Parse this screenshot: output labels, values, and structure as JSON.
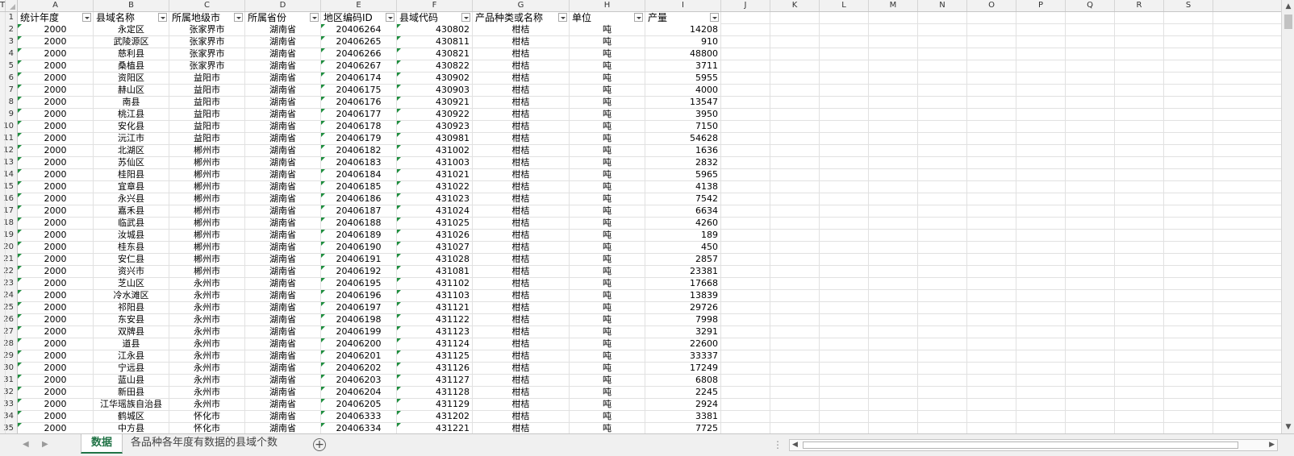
{
  "columns": [
    "A",
    "B",
    "C",
    "D",
    "E",
    "F",
    "G",
    "H",
    "I",
    "J",
    "K",
    "L",
    "M",
    "N",
    "O",
    "P",
    "Q",
    "R",
    "S",
    "T"
  ],
  "headers": [
    "统计年度",
    "县域名称",
    "所属地级市",
    "所属省份",
    "地区编码ID",
    "县域代码",
    "产品种类或名称",
    "单位",
    "产量"
  ],
  "rows": [
    [
      "2000",
      "永定区",
      "张家界市",
      "湖南省",
      "20406264",
      "430802",
      "柑桔",
      "吨",
      "14208"
    ],
    [
      "2000",
      "武陵源区",
      "张家界市",
      "湖南省",
      "20406265",
      "430811",
      "柑桔",
      "吨",
      "910"
    ],
    [
      "2000",
      "慈利县",
      "张家界市",
      "湖南省",
      "20406266",
      "430821",
      "柑桔",
      "吨",
      "48800"
    ],
    [
      "2000",
      "桑植县",
      "张家界市",
      "湖南省",
      "20406267",
      "430822",
      "柑桔",
      "吨",
      "3711"
    ],
    [
      "2000",
      "资阳区",
      "益阳市",
      "湖南省",
      "20406174",
      "430902",
      "柑桔",
      "吨",
      "5955"
    ],
    [
      "2000",
      "赫山区",
      "益阳市",
      "湖南省",
      "20406175",
      "430903",
      "柑桔",
      "吨",
      "4000"
    ],
    [
      "2000",
      "南县",
      "益阳市",
      "湖南省",
      "20406176",
      "430921",
      "柑桔",
      "吨",
      "13547"
    ],
    [
      "2000",
      "桃江县",
      "益阳市",
      "湖南省",
      "20406177",
      "430922",
      "柑桔",
      "吨",
      "3950"
    ],
    [
      "2000",
      "安化县",
      "益阳市",
      "湖南省",
      "20406178",
      "430923",
      "柑桔",
      "吨",
      "7150"
    ],
    [
      "2000",
      "沅江市",
      "益阳市",
      "湖南省",
      "20406179",
      "430981",
      "柑桔",
      "吨",
      "54628"
    ],
    [
      "2000",
      "北湖区",
      "郴州市",
      "湖南省",
      "20406182",
      "431002",
      "柑桔",
      "吨",
      "1636"
    ],
    [
      "2000",
      "苏仙区",
      "郴州市",
      "湖南省",
      "20406183",
      "431003",
      "柑桔",
      "吨",
      "2832"
    ],
    [
      "2000",
      "桂阳县",
      "郴州市",
      "湖南省",
      "20406184",
      "431021",
      "柑桔",
      "吨",
      "5965"
    ],
    [
      "2000",
      "宜章县",
      "郴州市",
      "湖南省",
      "20406185",
      "431022",
      "柑桔",
      "吨",
      "4138"
    ],
    [
      "2000",
      "永兴县",
      "郴州市",
      "湖南省",
      "20406186",
      "431023",
      "柑桔",
      "吨",
      "7542"
    ],
    [
      "2000",
      "嘉禾县",
      "郴州市",
      "湖南省",
      "20406187",
      "431024",
      "柑桔",
      "吨",
      "6634"
    ],
    [
      "2000",
      "临武县",
      "郴州市",
      "湖南省",
      "20406188",
      "431025",
      "柑桔",
      "吨",
      "4260"
    ],
    [
      "2000",
      "汝城县",
      "郴州市",
      "湖南省",
      "20406189",
      "431026",
      "柑桔",
      "吨",
      "189"
    ],
    [
      "2000",
      "桂东县",
      "郴州市",
      "湖南省",
      "20406190",
      "431027",
      "柑桔",
      "吨",
      "450"
    ],
    [
      "2000",
      "安仁县",
      "郴州市",
      "湖南省",
      "20406191",
      "431028",
      "柑桔",
      "吨",
      "2857"
    ],
    [
      "2000",
      "资兴市",
      "郴州市",
      "湖南省",
      "20406192",
      "431081",
      "柑桔",
      "吨",
      "23381"
    ],
    [
      "2000",
      "芝山区",
      "永州市",
      "湖南省",
      "20406195",
      "431102",
      "柑桔",
      "吨",
      "17668"
    ],
    [
      "2000",
      "冷水滩区",
      "永州市",
      "湖南省",
      "20406196",
      "431103",
      "柑桔",
      "吨",
      "13839"
    ],
    [
      "2000",
      "祁阳县",
      "永州市",
      "湖南省",
      "20406197",
      "431121",
      "柑桔",
      "吨",
      "29726"
    ],
    [
      "2000",
      "东安县",
      "永州市",
      "湖南省",
      "20406198",
      "431122",
      "柑桔",
      "吨",
      "7998"
    ],
    [
      "2000",
      "双牌县",
      "永州市",
      "湖南省",
      "20406199",
      "431123",
      "柑桔",
      "吨",
      "3291"
    ],
    [
      "2000",
      "道县",
      "永州市",
      "湖南省",
      "20406200",
      "431124",
      "柑桔",
      "吨",
      "22600"
    ],
    [
      "2000",
      "江永县",
      "永州市",
      "湖南省",
      "20406201",
      "431125",
      "柑桔",
      "吨",
      "33337"
    ],
    [
      "2000",
      "宁远县",
      "永州市",
      "湖南省",
      "20406202",
      "431126",
      "柑桔",
      "吨",
      "17249"
    ],
    [
      "2000",
      "蓝山县",
      "永州市",
      "湖南省",
      "20406203",
      "431127",
      "柑桔",
      "吨",
      "6808"
    ],
    [
      "2000",
      "新田县",
      "永州市",
      "湖南省",
      "20406204",
      "431128",
      "柑桔",
      "吨",
      "2245"
    ],
    [
      "2000",
      "江华瑶族自治县",
      "永州市",
      "湖南省",
      "20406205",
      "431129",
      "柑桔",
      "吨",
      "2924"
    ],
    [
      "2000",
      "鹤城区",
      "怀化市",
      "湖南省",
      "20406333",
      "431202",
      "柑桔",
      "吨",
      "3381"
    ],
    [
      "2000",
      "中方县",
      "怀化市",
      "湖南省",
      "20406334",
      "431221",
      "柑桔",
      "吨",
      "7725"
    ]
  ],
  "sheet_tabs": [
    "数据",
    "各品种各年度有数据的县域个数"
  ],
  "active_tab": "数据",
  "icons": {
    "filter": "filter-dropdown-icon",
    "add_sheet": "plus-circle-icon",
    "nav_prev": "chevron-left-icon",
    "nav_next": "chevron-right-icon"
  },
  "colors": {
    "active_tab": "#217346",
    "error_indicator": "#1e8e3e",
    "header_bg": "#f2f2f2",
    "gridline": "#e1e1e1"
  }
}
